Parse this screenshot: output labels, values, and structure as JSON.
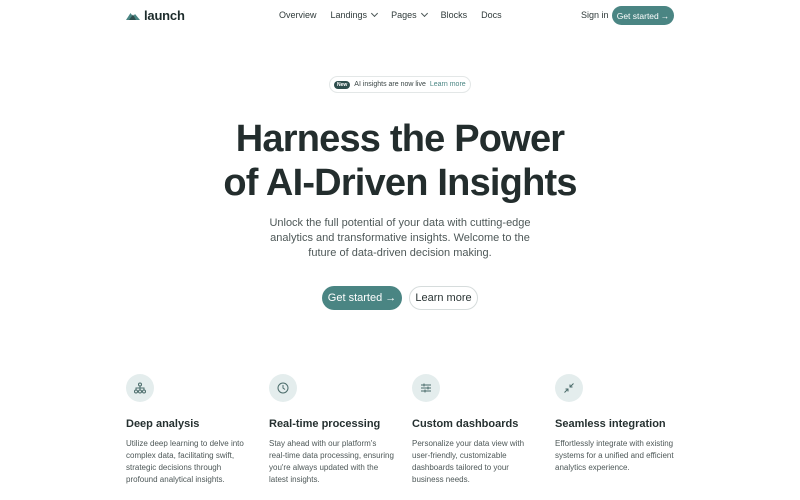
{
  "nav": {
    "logo_text": "launch",
    "links": [
      {
        "label": "Overview"
      },
      {
        "label": "Landings"
      },
      {
        "label": "Pages"
      },
      {
        "label": "Blocks"
      },
      {
        "label": "Docs"
      }
    ],
    "signin_label": "Sign in",
    "cta_label": "Get started",
    "cta_arrow": "→"
  },
  "announcement": {
    "badge": "New",
    "text": "AI insights are now live",
    "link": "Learn more"
  },
  "hero": {
    "headline_line1": "Harness the Power",
    "headline_line2": "of AI-Driven Insights",
    "subtitle": "Unlock the full potential of your data with cutting-edge analytics and transformative insights. Welcome to the future of data-driven decision making.",
    "cta_primary": "Get started",
    "cta_arrow": "→",
    "cta_secondary": "Learn more"
  },
  "features": [
    {
      "icon": "network-icon",
      "title": "Deep analysis",
      "description": "Utilize deep learning to delve into complex data, facilitating swift, strategic decisions through profound analytical insights."
    },
    {
      "icon": "clock-icon",
      "title": "Real-time processing",
      "description": "Stay ahead with our platform's real-time data processing, ensuring you're always updated with the latest insights."
    },
    {
      "icon": "sliders-icon",
      "title": "Custom dashboards",
      "description": "Personalize your data view with user-friendly, customizable dashboards tailored to your business needs."
    },
    {
      "icon": "minimize-icon",
      "title": "Seamless integration",
      "description": "Effortlessly integrate with existing systems for a unified and efficient analytics experience."
    }
  ],
  "colors": {
    "accent": "#4a8583",
    "text": "#232d2d",
    "icon_bg": "#e4eded"
  }
}
